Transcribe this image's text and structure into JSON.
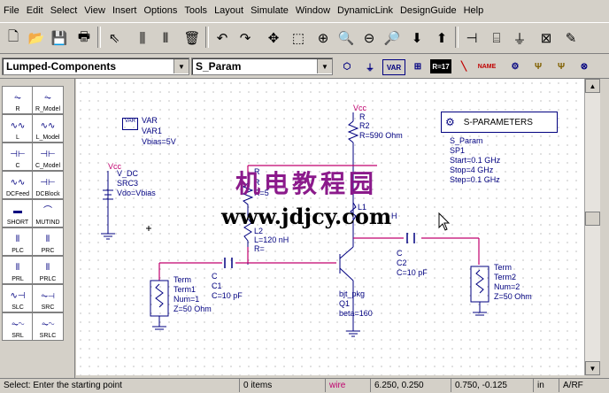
{
  "menu": {
    "items": [
      "File",
      "Edit",
      "Select",
      "View",
      "Insert",
      "Options",
      "Tools",
      "Layout",
      "Simulate",
      "Window",
      "DynamicLink",
      "DesignGuide",
      "Help"
    ]
  },
  "toolbar2": {
    "library": "Lumped-Components",
    "simulation": "S_Param",
    "var_label": "VAR",
    "eqn_label": "R=17",
    "name_label": "NAME"
  },
  "palette": {
    "items": [
      "R",
      "R_Model",
      "L",
      "L_Model",
      "C",
      "C_Model",
      "DCFeed",
      "DCBlock",
      "SHORT",
      "MUTIND",
      "PLC",
      "PRC",
      "PRL",
      "PRLC",
      "SLC",
      "SRC",
      "SRL",
      "SRLC"
    ]
  },
  "schematic": {
    "var": {
      "name": "VAR",
      "inst": "VAR1",
      "value": "Vbias=5V",
      "icon": "VAR"
    },
    "src": {
      "vcc": "Vcc",
      "type": "V_DC",
      "inst": "SRC3",
      "value": "Vdo=Vbias"
    },
    "r2": {
      "vcc": "Vcc",
      "type": "R",
      "inst": "R2",
      "value": "R=590 Ohm"
    },
    "r1": {
      "type": "R",
      "inst": "R",
      "value": "R=5"
    },
    "l2": {
      "type": "L",
      "inst": "L2",
      "value": "L=120 nH",
      "r": "R="
    },
    "l1": {
      "inst": "L1",
      "value": "H"
    },
    "sparam": {
      "title": "S-PARAMETERS",
      "type": "S_Param",
      "inst": "SP1",
      "start": "Start=0.1 GHz",
      "stop": "Stop=4 GHz",
      "step": "Step=0.1 GHz"
    },
    "term1": {
      "type": "Term",
      "inst": "Term1",
      "num": "Num=1",
      "z": "Z=50 Ohm"
    },
    "term2": {
      "type": "Term",
      "inst": "Term2",
      "num": "Num=2",
      "z": "Z=50 Ohm"
    },
    "c1": {
      "type": "C",
      "inst": "C1",
      "value": "C=10 pF"
    },
    "c2": {
      "type": "C",
      "inst": "C2",
      "value": "C=10 pF"
    },
    "bjt": {
      "type": "bjt_pkg",
      "inst": "Q1",
      "value": "beta=160"
    }
  },
  "watermark": {
    "cn": "机电教程园",
    "url": "www.jdjcy.com"
  },
  "status": {
    "message": "Select: Enter the starting point",
    "items": "0 items",
    "mode": "wire",
    "coords1": "6.250, 0.250",
    "coords2": "0.750, -0.125",
    "unit": "in",
    "category": "A/RF"
  },
  "colors": {
    "wire": "#c0006e",
    "schematic": "#000080",
    "watermark": "#8b1a8b"
  }
}
